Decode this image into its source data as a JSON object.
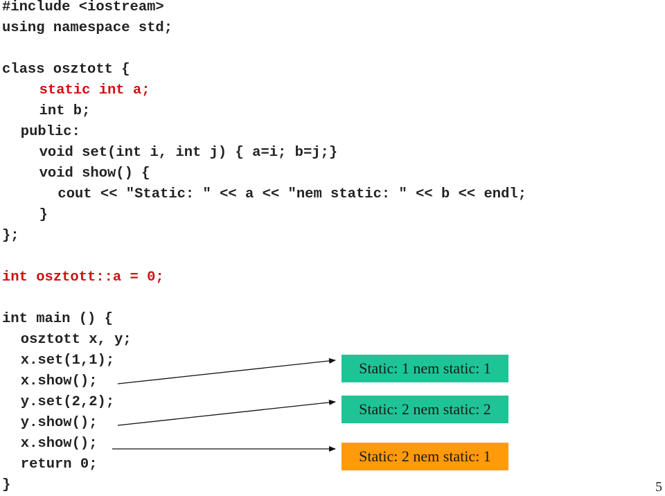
{
  "code_lines": [
    {
      "text": "#include <iostream>",
      "indent": 0,
      "highlight": false
    },
    {
      "text": "using namespace std;",
      "indent": 0,
      "highlight": false
    },
    {
      "text": "",
      "indent": 0,
      "highlight": false
    },
    {
      "text": "class osztott {",
      "indent": 0,
      "highlight": false
    },
    {
      "text": "static int a;",
      "indent": 4,
      "highlight": true
    },
    {
      "text": "int b;",
      "indent": 4,
      "highlight": false
    },
    {
      "text": "public:",
      "indent": 2,
      "highlight": false
    },
    {
      "text": "void set(int i, int j) { a=i; b=j;}",
      "indent": 4,
      "highlight": false
    },
    {
      "text": "void show() {",
      "indent": 4,
      "highlight": false
    },
    {
      "text": "cout << \"Static: \" << a << \"nem static: \" << b << endl;",
      "indent": 6,
      "highlight": false
    },
    {
      "text": "}",
      "indent": 4,
      "highlight": false
    },
    {
      "text": "};",
      "indent": 0,
      "highlight": false
    },
    {
      "text": "",
      "indent": 0,
      "highlight": false
    },
    {
      "text": "int osztott::a = 0;",
      "indent": 0,
      "highlight": true
    },
    {
      "text": "",
      "indent": 0,
      "highlight": false
    },
    {
      "text": "int main () {",
      "indent": 0,
      "highlight": false
    },
    {
      "text": "osztott x, y;",
      "indent": 2,
      "highlight": false
    },
    {
      "text": "x.set(1,1);",
      "indent": 2,
      "highlight": false
    },
    {
      "text": "x.show();",
      "indent": 2,
      "highlight": false
    },
    {
      "text": "y.set(2,2);",
      "indent": 2,
      "highlight": false
    },
    {
      "text": "y.show();",
      "indent": 2,
      "highlight": false
    },
    {
      "text": "x.show();",
      "indent": 2,
      "highlight": false
    },
    {
      "text": "return 0;",
      "indent": 2,
      "highlight": false
    },
    {
      "text": "}",
      "indent": 0,
      "highlight": false
    }
  ],
  "outputs": [
    {
      "text": "Static: 1 nem static: 1",
      "color": "#1ec496",
      "from_line": 18
    },
    {
      "text": "Static: 2 nem static: 2",
      "color": "#1ec496",
      "from_line": 20
    },
    {
      "text": "Static: 2 nem static: 1",
      "color": "#ff9a0a",
      "from_line": 21
    }
  ],
  "colors": {
    "code_text": "#222222",
    "highlight": "#d01010"
  },
  "page_number": "5"
}
